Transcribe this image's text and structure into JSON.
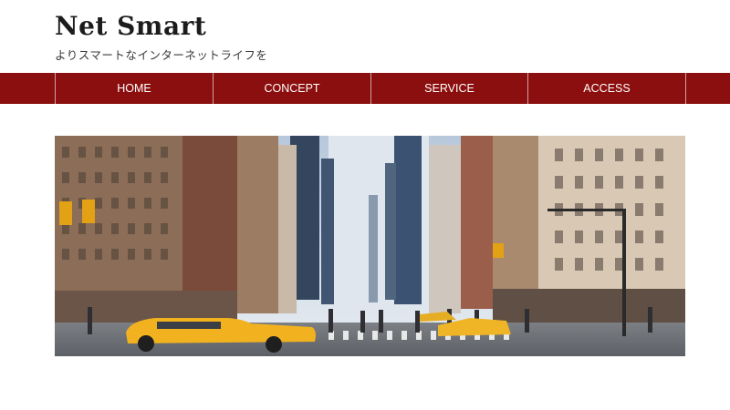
{
  "site": {
    "logo": "Net Smart",
    "tagline": "よりスマートなインターネットライフを"
  },
  "nav": {
    "items": [
      {
        "label": "HOME"
      },
      {
        "label": "CONCEPT"
      },
      {
        "label": "SERVICE"
      },
      {
        "label": "ACCESS"
      }
    ]
  },
  "colors": {
    "nav_background": "#8b0f0e",
    "nav_text": "#ffffff",
    "logo_text": "#1c1c1c"
  },
  "hero": {
    "image": "city-street-photo"
  }
}
